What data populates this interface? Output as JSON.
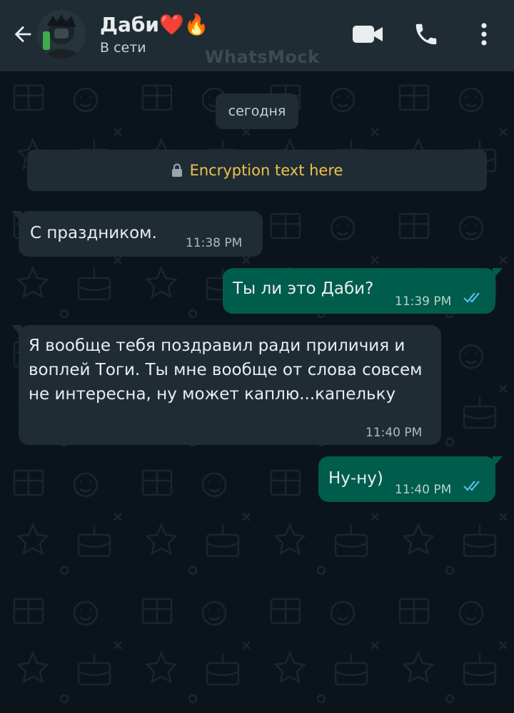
{
  "header": {
    "contact_name": "Даби❤️🔥",
    "status": "В сети",
    "watermark": "WhatsMock"
  },
  "chat": {
    "date_chip": "сегодня",
    "encryption_text": "Encryption text here",
    "messages": [
      {
        "direction": "incoming",
        "text": "С праздником.",
        "time": "11:38 PM"
      },
      {
        "direction": "outgoing",
        "text": "Ты ли это Даби?",
        "time": "11:39 PM",
        "read": true
      },
      {
        "direction": "incoming",
        "text": "Я вообще тебя поздравил ради приличия и воплей Тоги. Ты мне вообще от слова совсем не интересна, ну может каплю...капельку",
        "time": "11:40 PM"
      },
      {
        "direction": "outgoing",
        "text": "Ну-ну)",
        "time": "11:40 PM",
        "read": true
      }
    ]
  },
  "colors": {
    "header_bg": "#1f2c34",
    "chat_bg": "#0b141a",
    "incoming_bubble": "#1f2c34",
    "outgoing_bubble": "#005c4b",
    "read_tick": "#53bdeb",
    "encryption_text": "#f0c14b"
  },
  "icons": {
    "back": "arrow-left-icon",
    "video": "video-camera-icon",
    "call": "phone-icon",
    "menu": "more-vertical-icon",
    "lock": "lock-icon",
    "read": "double-check-icon"
  }
}
